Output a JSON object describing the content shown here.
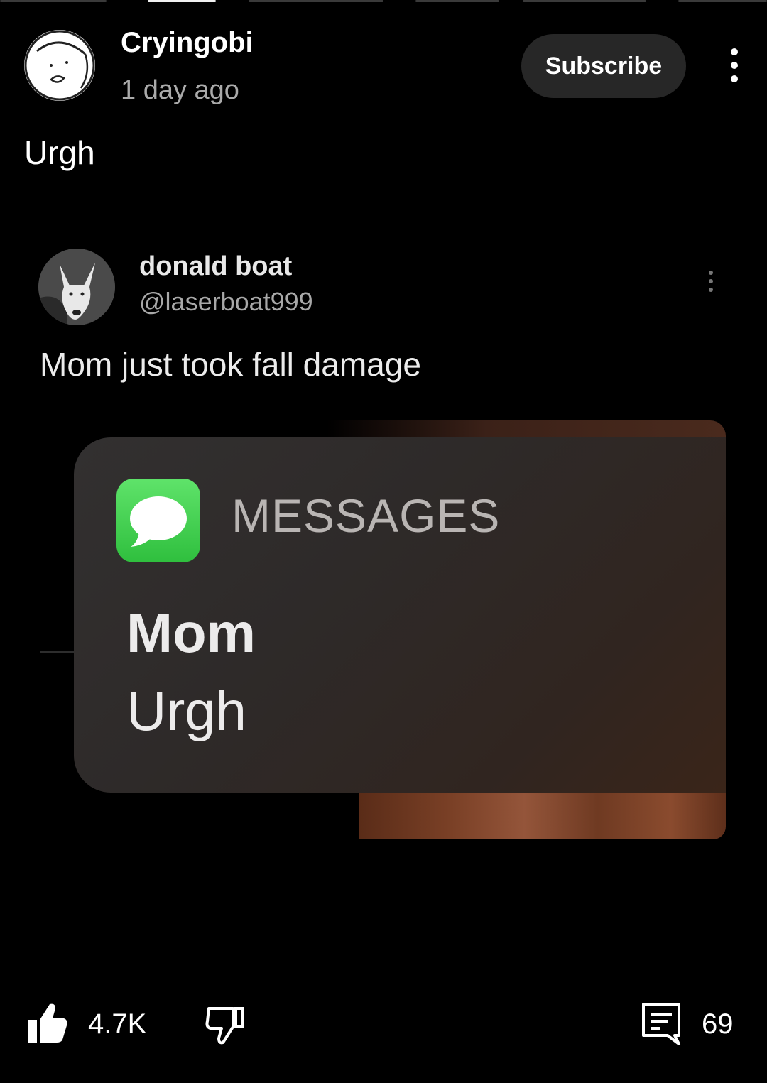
{
  "post": {
    "channel_name": "Cryingobi",
    "time": "1 day ago",
    "subscribe_label": "Subscribe",
    "text": "Urgh"
  },
  "image": {
    "tweet": {
      "name": "donald boat",
      "handle": "@laserboat999",
      "text": "Mom just took fall damage"
    },
    "notification": {
      "app_label": "MESSAGES",
      "sender": "Mom",
      "message": "Urgh"
    }
  },
  "actions": {
    "like_count": "4.7K",
    "comment_count": "69"
  },
  "icons": {
    "like": "thumbs-up-icon",
    "dislike": "thumbs-down-icon",
    "comment": "comment-icon",
    "more": "more-vertical-icon",
    "messages_app": "messages-app-icon"
  },
  "colors": {
    "background": "#000000",
    "subscribe_bg": "#272727",
    "secondary_text": "#aaaaaa",
    "messages_green": "#34c759"
  }
}
